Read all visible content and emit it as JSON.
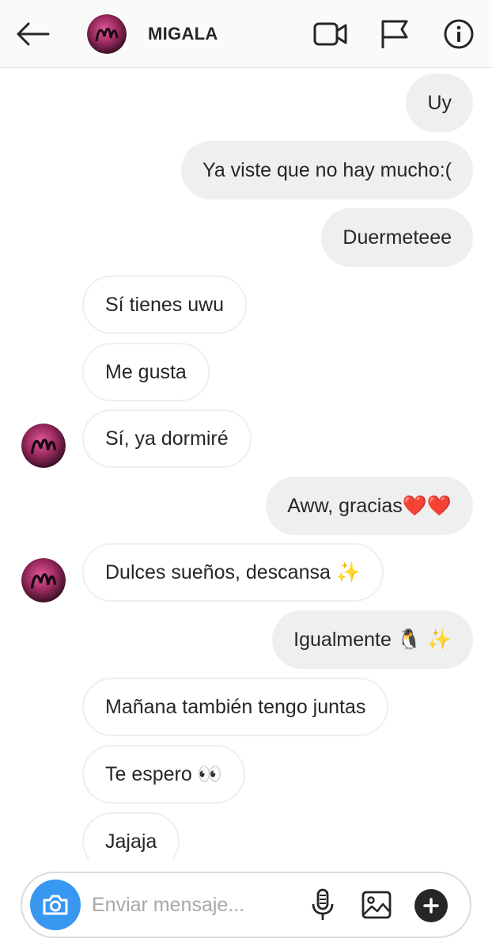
{
  "header": {
    "contact_name": "MIGALA",
    "back_icon": "arrow-left-icon",
    "video_icon": "video-camera-icon",
    "flag_icon": "flag-icon",
    "info_icon": "info-icon"
  },
  "messages": [
    {
      "from": "me",
      "text": "Uy"
    },
    {
      "from": "me",
      "text": "Ya viste que no hay mucho:("
    },
    {
      "from": "me",
      "text": "Duermeteee"
    },
    {
      "from": "them",
      "text": "Sí tienes uwu"
    },
    {
      "from": "them",
      "text": "Me gusta"
    },
    {
      "from": "them",
      "text": "Sí, ya dormiré"
    },
    {
      "from": "me",
      "text": "Aww, gracias❤️❤️"
    },
    {
      "from": "them",
      "text": "Dulces sueños, descansa ✨"
    },
    {
      "from": "me",
      "text": "Igualmente 🐧 ✨"
    },
    {
      "from": "them",
      "text": "Mañana también tengo juntas"
    },
    {
      "from": "them",
      "text": "Te espero 👀"
    },
    {
      "from": "them",
      "text": "Jajaja"
    }
  ],
  "composer": {
    "placeholder": "Enviar mensaje...",
    "camera_icon": "camera-icon",
    "mic_icon": "microphone-icon",
    "gallery_icon": "image-icon",
    "plus_icon": "plus-icon"
  },
  "colors": {
    "sent_bubble": "#efefef",
    "received_border": "#efefef",
    "camera_button": "#3897f0",
    "text": "#262626",
    "placeholder": "#a8a8a8"
  }
}
